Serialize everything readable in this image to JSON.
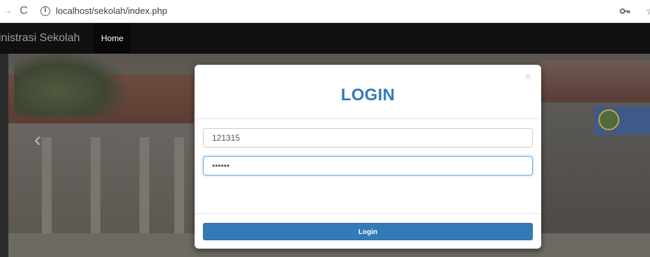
{
  "browser": {
    "back_glyph": "→",
    "reload_glyph": "C",
    "info_glyph": "i",
    "url": "localhost/sekolah/index.php",
    "star_glyph": "☆"
  },
  "navbar": {
    "brand": "inistrasi Sekolah",
    "home_label": "Home"
  },
  "carousel": {
    "prev_glyph": "‹"
  },
  "modal": {
    "close_glyph": "×",
    "title": "LOGIN",
    "username_value": "121315",
    "password_value": "123456",
    "login_label": "Login"
  },
  "colors": {
    "primary": "#337ab7",
    "navbar": "#101010",
    "focus_border": "#66afe9"
  }
}
